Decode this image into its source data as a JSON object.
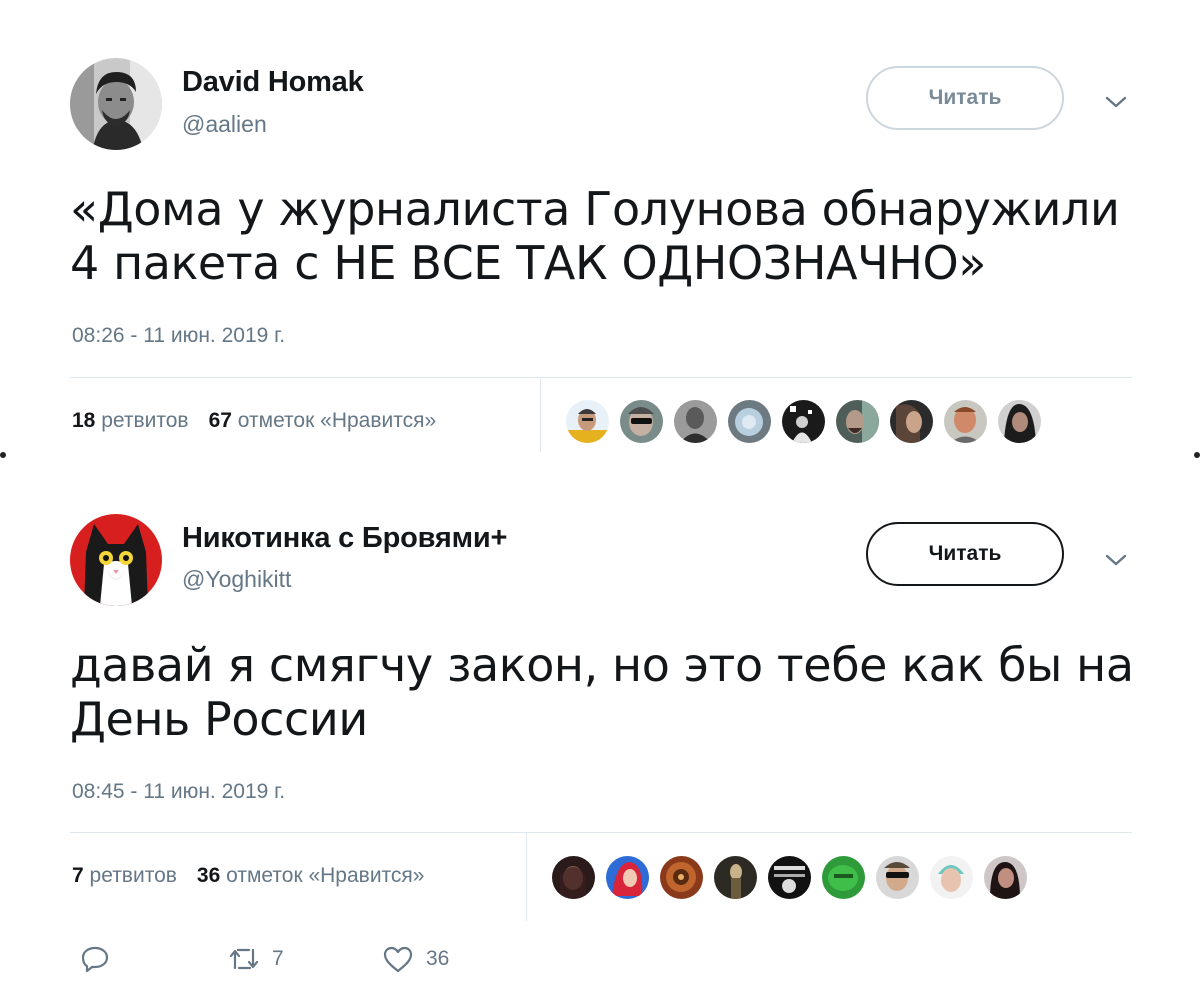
{
  "tweets": [
    {
      "name": "David Homak",
      "handle": "@aalien",
      "follow_label": "Читать",
      "text_line1": "«Дома у журналиста Голунова обнаружили",
      "text_line2": "4 пакета с НЕ ВСЕ ТАК ОДНОЗНАЧНО»",
      "timestamp": "08:26 - 11 июн. 2019 г.",
      "retweets_count": "18",
      "retweets_label": "ретвитов",
      "likes_count": "67",
      "likes_label": "отметок «Нравится»"
    },
    {
      "name": "Никотинка с Бровями+",
      "handle": "@Yoghikitt",
      "follow_label": "Читать",
      "text_line1": "давай я смягчу закон, но это тебе как бы на",
      "text_line2": "День России",
      "timestamp": "08:45 - 11 июн. 2019 г.",
      "retweets_count": "7",
      "retweets_label": "ретвитов",
      "likes_count": "36",
      "likes_label": "отметок «Нравится»",
      "actions": {
        "reply_icon": "reply-icon",
        "retweet_icon": "retweet-icon",
        "retweet_count": "7",
        "like_icon": "heart-icon",
        "like_count": "36"
      }
    }
  ],
  "colors": {
    "text": "#14171a",
    "secondary": "#657786",
    "border": "#e1e8ed",
    "follow_border_light": "#ccd6dd"
  }
}
